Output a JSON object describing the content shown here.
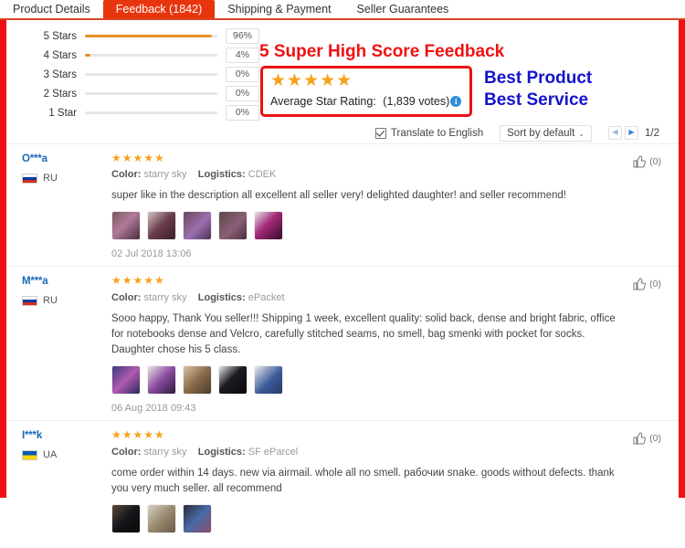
{
  "tabs": [
    {
      "label": "Product Details",
      "active": false
    },
    {
      "label": "Feedback (1842)",
      "active": true
    },
    {
      "label": "Shipping & Payment",
      "active": false
    },
    {
      "label": "Seller Guarantees",
      "active": false
    }
  ],
  "rating_breakdown": [
    {
      "label": "5 Stars",
      "percent": "96%",
      "value": 96
    },
    {
      "label": "4 Stars",
      "percent": "4%",
      "value": 4
    },
    {
      "label": "3 Stars",
      "percent": "0%",
      "value": 0
    },
    {
      "label": "2 Stars",
      "percent": "0%",
      "value": 0
    },
    {
      "label": "1 Star",
      "percent": "0%",
      "value": 0
    }
  ],
  "annotations": {
    "headline": "5 Super High Score Feedback",
    "best_product": "Best Product",
    "best_service": "Best Service",
    "highlight_color": "#ee1111",
    "blue_color": "#1414cc"
  },
  "average_rating": {
    "stars": "★★★★★",
    "label": "Average Star Rating:",
    "votes": "(1,839 votes)",
    "info_glyph": "i"
  },
  "toolbar": {
    "translate_label": "Translate to English",
    "translate_checked": true,
    "sort_label": "Sort by default",
    "sort_caret": "⌄",
    "prev_glyph": "◀",
    "next_glyph": "▶",
    "page_indicator": "1/2"
  },
  "reviews": [
    {
      "name": "O***a",
      "country_code": "RU",
      "flag": "flag-ru",
      "stars": "★★★★★",
      "color_key": "Color:",
      "color_value": "starry sky",
      "logistics_key": "Logistics:",
      "logistics_value": "CDEK",
      "text": "super like in the description all excellent all seller very! delighted daughter! and seller recommend!",
      "date": "02 Jul 2018 13:06",
      "likes": "(0)",
      "thumbs": [
        "#6b4a52",
        "#4a2e38",
        "#7a5f86",
        "#5c4048",
        "#8b2f66"
      ]
    },
    {
      "name": "M***a",
      "country_code": "RU",
      "flag": "flag-ru",
      "stars": "★★★★★",
      "color_key": "Color:",
      "color_value": "starry sky",
      "logistics_key": "Logistics:",
      "logistics_value": "ePacket",
      "text": "Sooo happy, Thank You seller!!! Shipping 1 week, excellent quality: solid back, dense and bright fabric, office for notebooks dense and Velcro, carefully stitched seams, no smell, bag smenki with pocket for socks. Daughter chose his 5 class.",
      "date": "06 Aug 2018 09:43",
      "likes": "(0)",
      "thumbs": [
        "#5b4a8c",
        "#6a4a8f",
        "#b08a62",
        "#1b1b22",
        "#3a5a9a"
      ]
    },
    {
      "name": "I***k",
      "country_code": "UA",
      "flag": "flag-ua",
      "stars": "★★★★★",
      "color_key": "Color:",
      "color_value": "starry sky",
      "logistics_key": "Logistics:",
      "logistics_value": "SF eParcel",
      "text": "come order within 14 days. new via airmail. whole all no smell. рабочии snake. goods without defects. thank you very much seller. all recommend",
      "date": "",
      "likes": "(0)",
      "thumbs": [
        "#2a2520",
        "#8c8070",
        "#3f5a86"
      ]
    }
  ]
}
